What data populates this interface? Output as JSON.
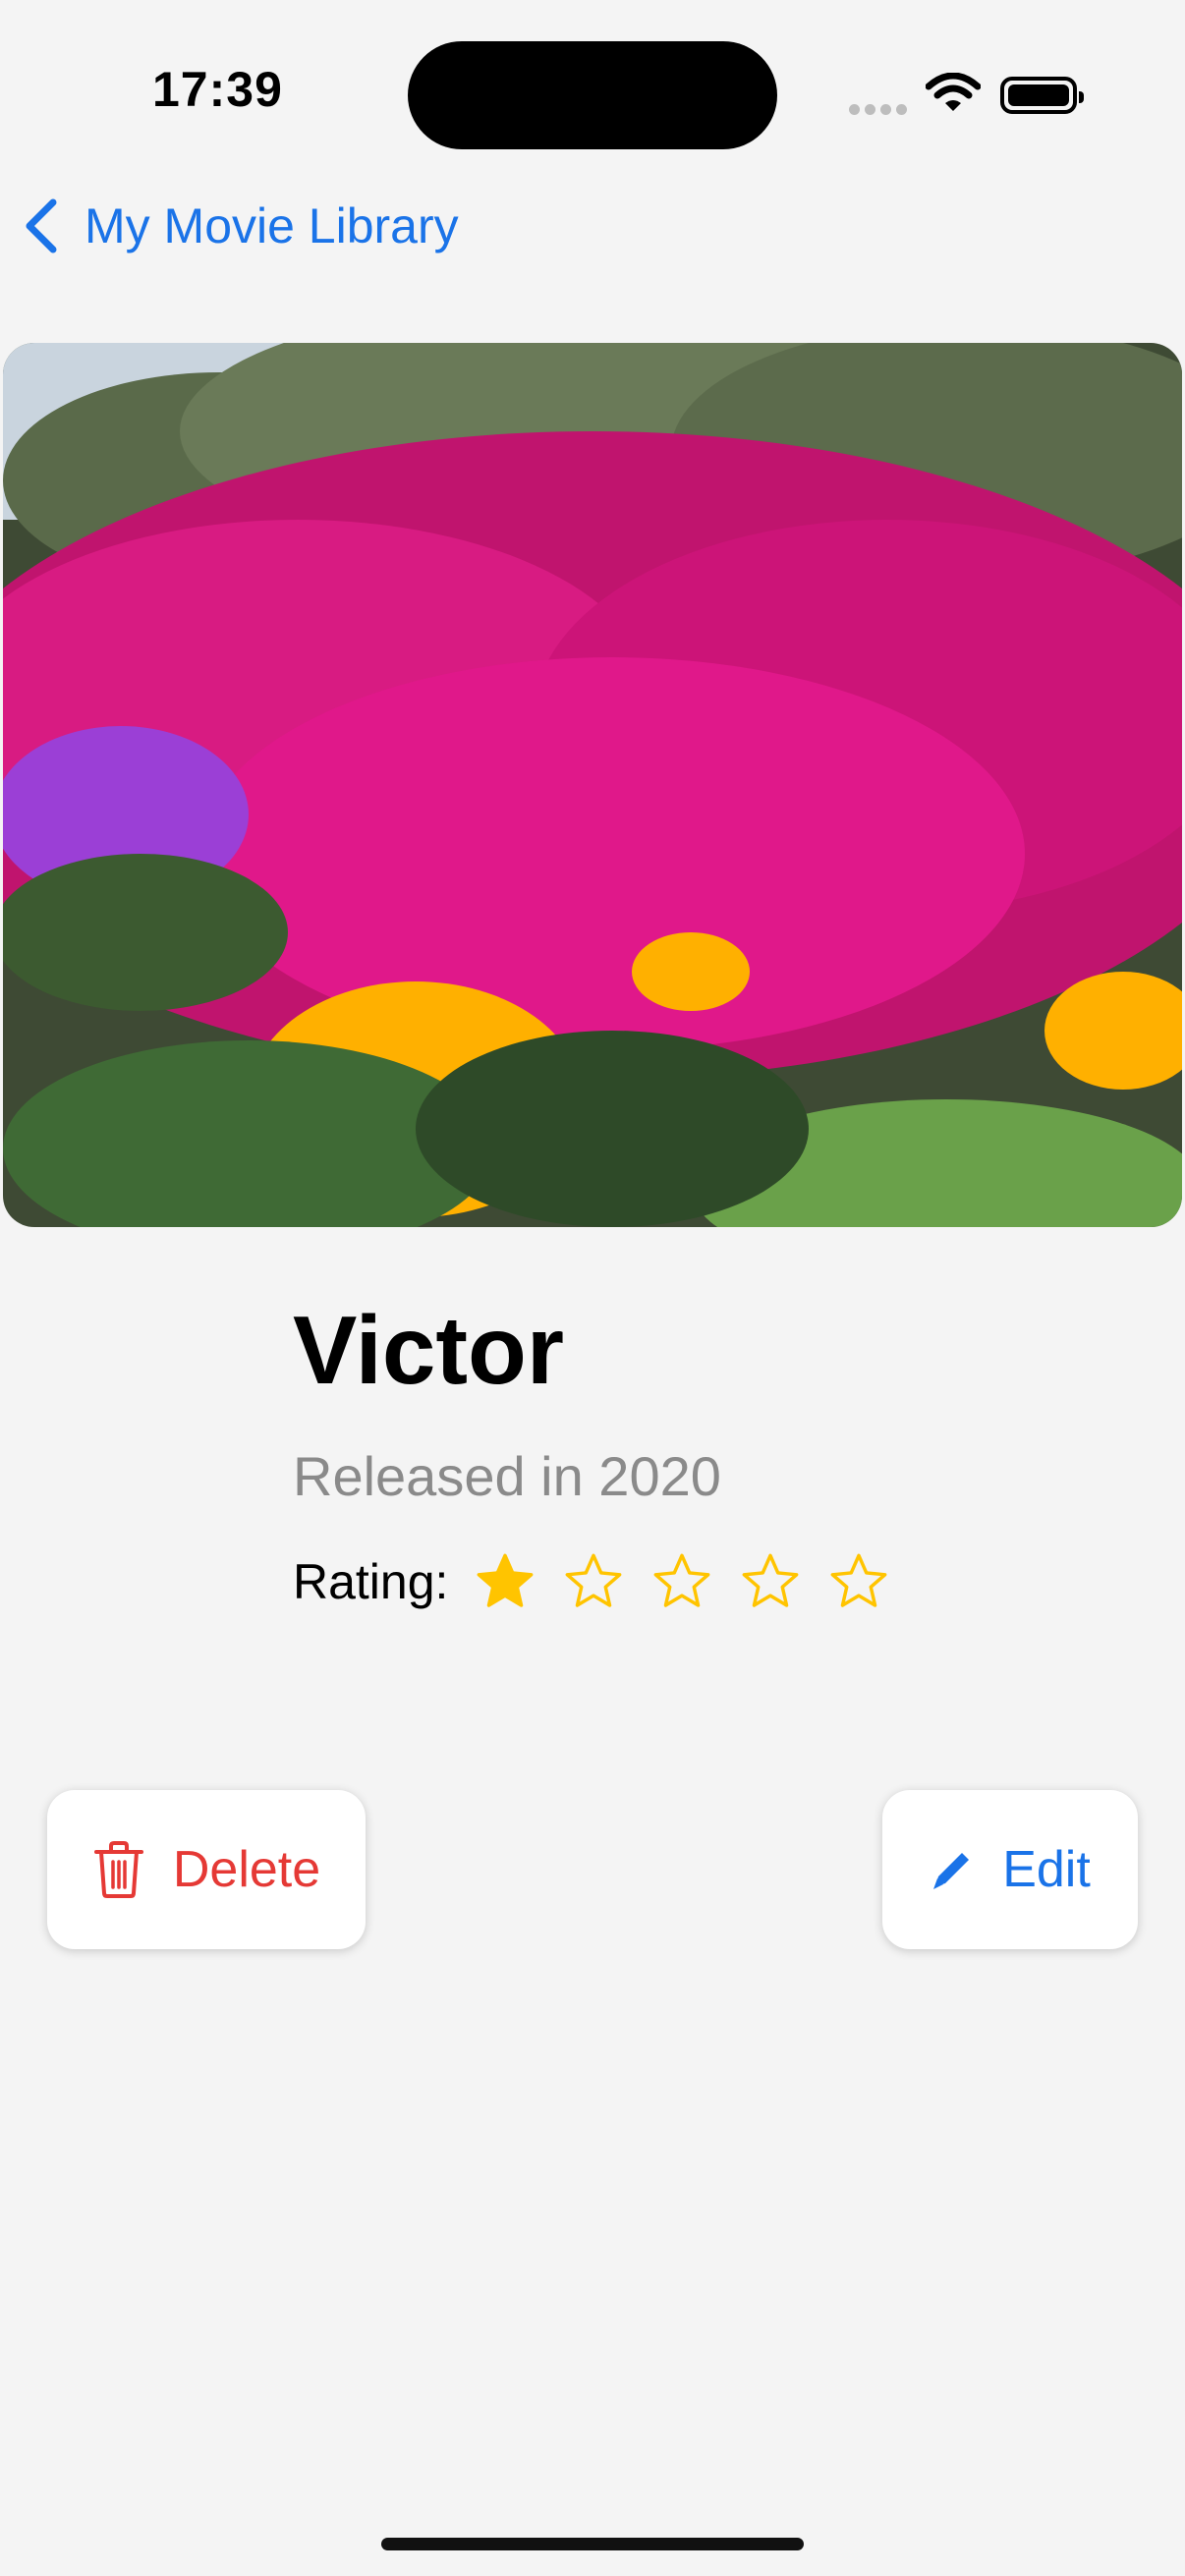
{
  "status_bar": {
    "time": "17:39"
  },
  "nav": {
    "back_label": "My Movie Library"
  },
  "movie": {
    "title": "Victor",
    "released": "Released in 2020",
    "rating_label": "Rating:",
    "rating": 1,
    "rating_max": 5
  },
  "actions": {
    "delete_label": "Delete",
    "edit_label": "Edit"
  },
  "colors": {
    "accent": "#1a73e8",
    "destructive": "#e53935",
    "star": "#ffc400"
  },
  "icons": [
    "chevron-left-icon",
    "trash-icon",
    "pencil-icon",
    "star-filled-icon",
    "star-outline-icon",
    "wifi-icon",
    "battery-icon"
  ]
}
